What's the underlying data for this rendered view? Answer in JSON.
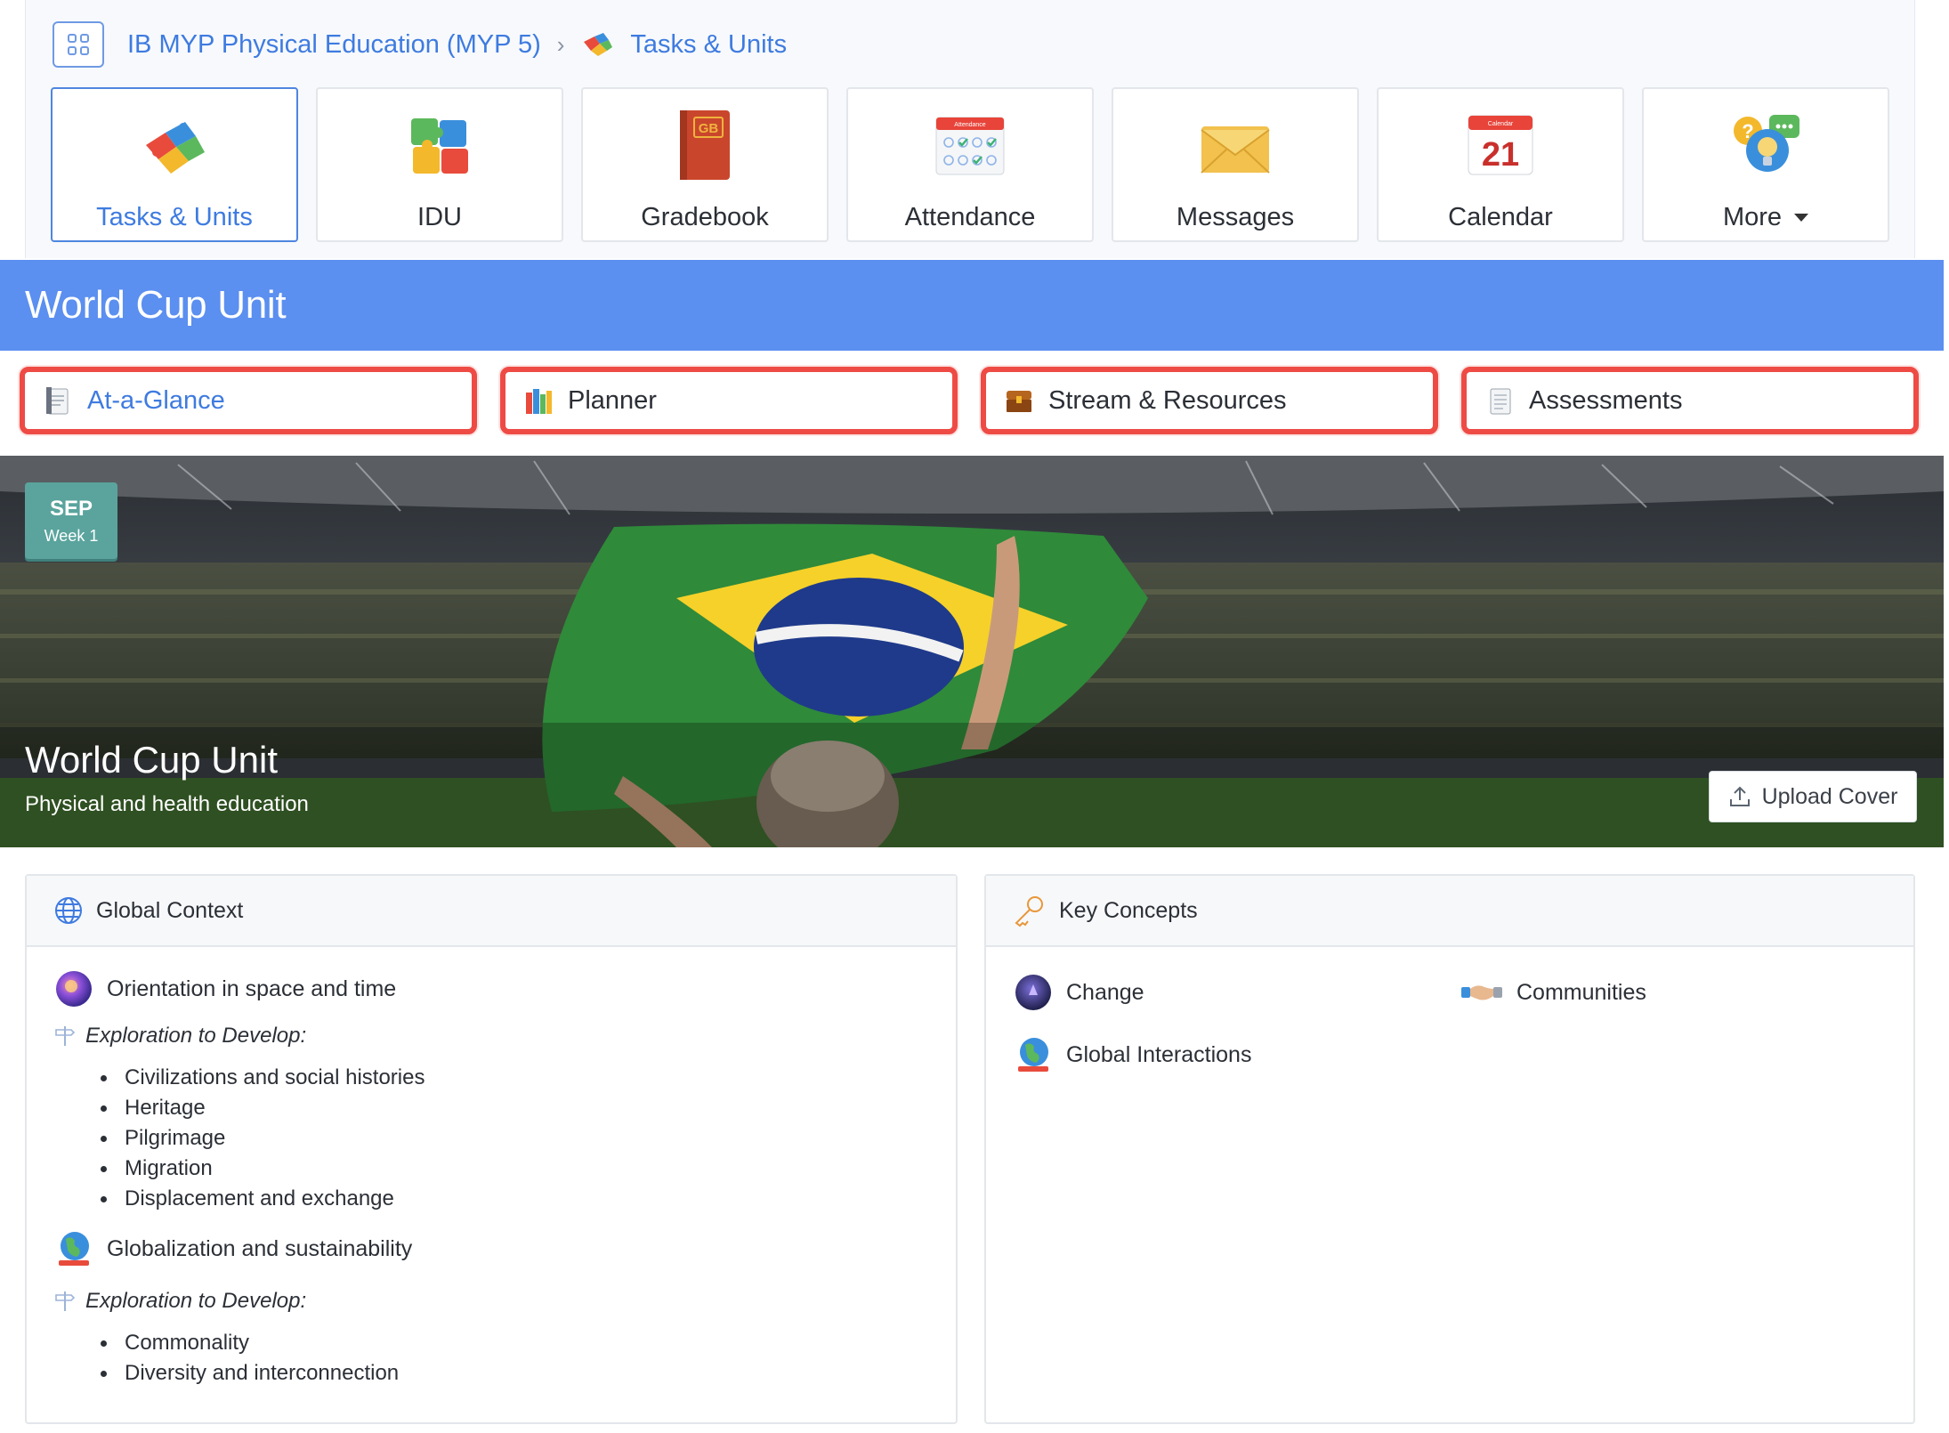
{
  "breadcrumb": {
    "course": "IB MYP Physical Education (MYP 5)",
    "current": "Tasks & Units"
  },
  "tiles": [
    {
      "label": "Tasks & Units",
      "icon": "puzzle-icon",
      "active": true
    },
    {
      "label": "IDU",
      "icon": "puzzle-multi-icon"
    },
    {
      "label": "Gradebook",
      "icon": "gradebook-icon",
      "badge": "GB"
    },
    {
      "label": "Attendance",
      "icon": "attendance-icon",
      "badge": "Attendance"
    },
    {
      "label": "Messages",
      "icon": "envelope-icon"
    },
    {
      "label": "Calendar",
      "icon": "calendar-icon",
      "badge": "Calendar",
      "day": "21"
    },
    {
      "label": "More",
      "icon": "help-chat-icon"
    }
  ],
  "unit": {
    "title": "World Cup Unit"
  },
  "subtabs": [
    {
      "label": "At-a-Glance",
      "icon": "notepad-icon",
      "active": true
    },
    {
      "label": "Planner",
      "icon": "books-icon"
    },
    {
      "label": "Stream & Resources",
      "icon": "chest-icon"
    },
    {
      "label": "Assessments",
      "icon": "document-icon"
    }
  ],
  "hero": {
    "month": "SEP",
    "week": "Week 1",
    "title": "World Cup Unit",
    "subtitle": "Physical and health education",
    "upload_label": "Upload Cover"
  },
  "global_context": {
    "heading": "Global Context",
    "contexts": [
      {
        "title": "Orientation in space and time",
        "icon": "orb-icon",
        "explore_label": "Exploration to Develop:",
        "items": [
          "Civilizations and social histories",
          "Heritage",
          "Pilgrimage",
          "Migration",
          "Displacement and exchange"
        ]
      },
      {
        "title": "Globalization and sustainability",
        "icon": "globe-icon",
        "explore_label": "Exploration to Develop:",
        "items": [
          "Commonality",
          "Diversity and interconnection"
        ]
      }
    ]
  },
  "key_concepts": {
    "heading": "Key Concepts",
    "items": [
      {
        "label": "Change",
        "icon": "change-orb-icon"
      },
      {
        "label": "Communities",
        "icon": "handshake-icon"
      },
      {
        "label": "Global Interactions",
        "icon": "globe-icon"
      }
    ]
  },
  "colors": {
    "accent": "#3e7be0",
    "band": "#5b8ff0",
    "tab_highlight": "#ee4b45",
    "date_badge": "#5aa49d"
  }
}
